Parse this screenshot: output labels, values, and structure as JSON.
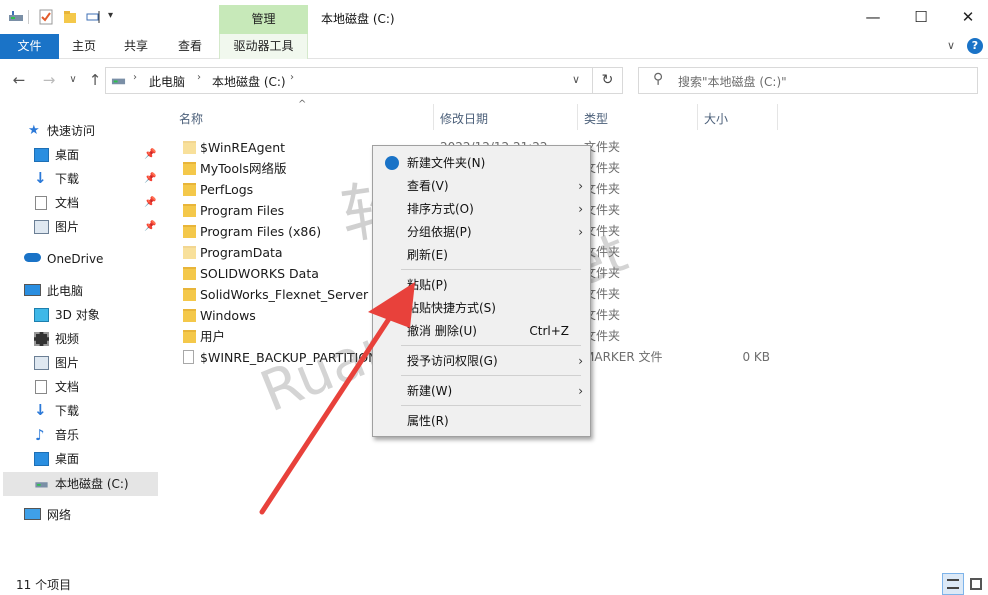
{
  "window": {
    "title": "本地磁盘 (C:)",
    "manage_tab": "管理",
    "minimize": "—",
    "maximize": "☐",
    "close": "✕"
  },
  "ribbon": {
    "tabs": [
      "文件",
      "主页",
      "共享",
      "查看",
      "驱动器工具"
    ]
  },
  "address": {
    "path": [
      "此电脑",
      "本地磁盘 (C:)"
    ],
    "search_placeholder": "搜索\"本地磁盘 (C:)\""
  },
  "nav": {
    "quick_access": "快速访问",
    "quick_items": [
      "桌面",
      "下载",
      "文档",
      "图片"
    ],
    "onedrive": "OneDrive",
    "this_pc": "此电脑",
    "pc_items": [
      "3D 对象",
      "视频",
      "图片",
      "文档",
      "下载",
      "音乐",
      "桌面",
      "本地磁盘 (C:)"
    ],
    "network": "网络"
  },
  "columns": [
    "名称",
    "修改日期",
    "类型",
    "大小"
  ],
  "files": [
    {
      "name": "$WinREAgent",
      "date": "2022/12/12 21:22",
      "type": "文件夹",
      "size": ""
    },
    {
      "name": "MyTools网络版",
      "date": "",
      "type": "文件夹",
      "size": ""
    },
    {
      "name": "PerfLogs",
      "date": "",
      "type": "文件夹",
      "size": ""
    },
    {
      "name": "Program Files",
      "date": "",
      "type": "文件夹",
      "size": ""
    },
    {
      "name": "Program Files (x86)",
      "date": "",
      "type": "文件夹",
      "size": ""
    },
    {
      "name": "ProgramData",
      "date": "",
      "type": "文件夹",
      "size": ""
    },
    {
      "name": "SOLIDWORKS Data",
      "date": "",
      "type": "文件夹",
      "size": ""
    },
    {
      "name": "SolidWorks_Flexnet_Server",
      "date": "",
      "type": "文件夹",
      "size": ""
    },
    {
      "name": "Windows",
      "date": "",
      "type": "文件夹",
      "size": ""
    },
    {
      "name": "用户",
      "date": "",
      "type": "文件夹",
      "size": ""
    },
    {
      "name": "$WINRE_BACKUP_PARTITION",
      "date": "",
      "type": "MARKER 文件",
      "size": "0 KB"
    }
  ],
  "context_menu": {
    "new_folder": "新建文件夹(N)",
    "view": "查看(V)",
    "sort": "排序方式(O)",
    "group": "分组依据(P)",
    "refresh": "刷新(E)",
    "paste": "粘贴(P)",
    "paste_shortcut": "粘贴快捷方式(S)",
    "undo_delete": "撤消 删除(U)",
    "undo_shortcut": "Ctrl+Z",
    "grant_access": "授予访问权限(G)",
    "new": "新建(W)",
    "properties": "属性(R)"
  },
  "watermark": {
    "line1": "软件网",
    "line2": "Ruanjiang.net"
  },
  "status": {
    "item_count": "11 个项目"
  },
  "colors": {
    "file_tab": "#1a73c7",
    "manage_tab": "#c7e9b9",
    "folder": "#f4c84a",
    "selected_nav": "#e5e5e5",
    "arrow": "#e8413b"
  }
}
